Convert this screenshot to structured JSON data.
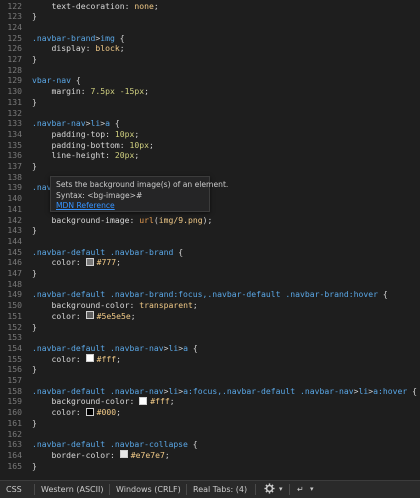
{
  "editor": {
    "lines": [
      {
        "n": "122",
        "parts": [
          [
            "prop",
            "    text-decoration"
          ],
          [
            "pun",
            ": "
          ],
          [
            "val",
            "none"
          ],
          [
            "pun",
            ";"
          ]
        ]
      },
      {
        "n": "123",
        "parts": [
          [
            "pun",
            "}"
          ]
        ]
      },
      {
        "n": "124",
        "parts": []
      },
      {
        "n": "125",
        "parts": [
          [
            "sel",
            ".navbar-brand"
          ],
          [
            "pun",
            ">"
          ],
          [
            "sel",
            "img"
          ],
          [
            "pun",
            " {"
          ]
        ]
      },
      {
        "n": "126",
        "parts": [
          [
            "prop",
            "    display"
          ],
          [
            "pun",
            ": "
          ],
          [
            "val",
            "block"
          ],
          [
            "pun",
            ";"
          ]
        ]
      },
      {
        "n": "127",
        "parts": [
          [
            "pun",
            "}"
          ]
        ]
      },
      {
        "n": "128",
        "parts": []
      },
      {
        "n": "129",
        "parts": [
          [
            "sel",
            "vbar-nav"
          ],
          [
            "pun",
            " {"
          ]
        ]
      },
      {
        "n": "130",
        "parts": [
          [
            "prop",
            "    margin"
          ],
          [
            "pun",
            ": "
          ],
          [
            "num",
            "7.5px -15px"
          ],
          [
            "pun",
            ";"
          ]
        ]
      },
      {
        "n": "131",
        "parts": [
          [
            "pun",
            "}"
          ]
        ]
      },
      {
        "n": "132",
        "parts": []
      },
      {
        "n": "133",
        "parts": [
          [
            "sel",
            ".navbar-nav"
          ],
          [
            "pun",
            ">"
          ],
          [
            "sel",
            "li"
          ],
          [
            "pun",
            ">"
          ],
          [
            "sel",
            "a"
          ],
          [
            "pun",
            " {"
          ]
        ]
      },
      {
        "n": "134",
        "parts": [
          [
            "prop",
            "    padding-top"
          ],
          [
            "pun",
            ": "
          ],
          [
            "num",
            "10px"
          ],
          [
            "pun",
            ";"
          ]
        ]
      },
      {
        "n": "135",
        "parts": [
          [
            "prop",
            "    padding-bottom"
          ],
          [
            "pun",
            ": "
          ],
          [
            "num",
            "10px"
          ],
          [
            "pun",
            ";"
          ]
        ]
      },
      {
        "n": "136",
        "parts": [
          [
            "prop",
            "    line-height"
          ],
          [
            "pun",
            ": "
          ],
          [
            "num",
            "20px"
          ],
          [
            "pun",
            ";"
          ]
        ]
      },
      {
        "n": "137",
        "parts": [
          [
            "pun",
            "}"
          ]
        ]
      },
      {
        "n": "138",
        "parts": []
      },
      {
        "n": "139",
        "parts": [
          [
            "sel",
            ".nav"
          ]
        ]
      },
      {
        "n": "140",
        "parts": []
      },
      {
        "n": "141",
        "parts": []
      },
      {
        "n": "142",
        "parts": [
          [
            "prop",
            "    background-image"
          ],
          [
            "pun",
            ": "
          ],
          [
            "kw",
            "url"
          ],
          [
            "pun",
            "("
          ],
          [
            "val",
            "img/9.png"
          ],
          [
            "pun",
            ");"
          ]
        ]
      },
      {
        "n": "143",
        "parts": [
          [
            "pun",
            "}"
          ]
        ]
      },
      {
        "n": "144",
        "parts": []
      },
      {
        "n": "145",
        "parts": [
          [
            "sel",
            ".navbar-default .navbar-brand"
          ],
          [
            "pun",
            " {"
          ]
        ]
      },
      {
        "n": "146",
        "parts": [
          [
            "prop",
            "    color"
          ],
          [
            "pun",
            ": "
          ],
          [
            "sw",
            "#777777"
          ],
          [
            "val",
            "#777"
          ],
          [
            "pun",
            ";"
          ]
        ]
      },
      {
        "n": "147",
        "parts": [
          [
            "pun",
            "}"
          ]
        ]
      },
      {
        "n": "148",
        "parts": []
      },
      {
        "n": "149",
        "parts": [
          [
            "sel",
            ".navbar-default .navbar-brand:focus,.navbar-default .navbar-brand:hover"
          ],
          [
            "pun",
            " {"
          ]
        ]
      },
      {
        "n": "150",
        "parts": [
          [
            "prop",
            "    background-color"
          ],
          [
            "pun",
            ": "
          ],
          [
            "val",
            "transparent"
          ],
          [
            "pun",
            ";"
          ]
        ]
      },
      {
        "n": "151",
        "parts": [
          [
            "prop",
            "    color"
          ],
          [
            "pun",
            ": "
          ],
          [
            "sw",
            "#5e5e5e"
          ],
          [
            "val",
            "#5e5e5e"
          ],
          [
            "pun",
            ";"
          ]
        ]
      },
      {
        "n": "152",
        "parts": [
          [
            "pun",
            "}"
          ]
        ]
      },
      {
        "n": "153",
        "parts": []
      },
      {
        "n": "154",
        "parts": [
          [
            "sel",
            ".navbar-default .navbar-nav"
          ],
          [
            "pun",
            ">"
          ],
          [
            "sel",
            "li"
          ],
          [
            "pun",
            ">"
          ],
          [
            "sel",
            "a"
          ],
          [
            "pun",
            " {"
          ]
        ]
      },
      {
        "n": "155",
        "parts": [
          [
            "prop",
            "    color"
          ],
          [
            "pun",
            ": "
          ],
          [
            "sw",
            "#ffffff"
          ],
          [
            "val",
            "#fff"
          ],
          [
            "pun",
            ";"
          ]
        ]
      },
      {
        "n": "156",
        "parts": [
          [
            "pun",
            "}"
          ]
        ]
      },
      {
        "n": "157",
        "parts": []
      },
      {
        "n": "158",
        "parts": [
          [
            "sel",
            ".navbar-default .navbar-nav"
          ],
          [
            "pun",
            ">"
          ],
          [
            "sel",
            "li"
          ],
          [
            "pun",
            ">"
          ],
          [
            "sel",
            "a:focus,.navbar-default .navbar-nav"
          ],
          [
            "pun",
            ">"
          ],
          [
            "sel",
            "li"
          ],
          [
            "pun",
            ">"
          ],
          [
            "sel",
            "a:hover"
          ],
          [
            "pun",
            " {"
          ]
        ]
      },
      {
        "n": "159",
        "parts": [
          [
            "prop",
            "    background-color"
          ],
          [
            "pun",
            ": "
          ],
          [
            "sw",
            "#ffffff"
          ],
          [
            "val",
            "#fff"
          ],
          [
            "pun",
            ";"
          ]
        ]
      },
      {
        "n": "160",
        "parts": [
          [
            "prop",
            "    color"
          ],
          [
            "pun",
            ": "
          ],
          [
            "sw",
            "#000000"
          ],
          [
            "val",
            "#000"
          ],
          [
            "pun",
            ";"
          ]
        ]
      },
      {
        "n": "161",
        "parts": [
          [
            "pun",
            "}"
          ]
        ]
      },
      {
        "n": "162",
        "parts": []
      },
      {
        "n": "163",
        "parts": [
          [
            "sel",
            ".navbar-default .navbar-collapse"
          ],
          [
            "pun",
            " {"
          ]
        ]
      },
      {
        "n": "164",
        "parts": [
          [
            "prop",
            "    border-color"
          ],
          [
            "pun",
            ": "
          ],
          [
            "sw",
            "#e7e7e7"
          ],
          [
            "val",
            "#e7e7e7"
          ],
          [
            "pun",
            ";"
          ]
        ]
      },
      {
        "n": "165",
        "parts": [
          [
            "pun",
            "}"
          ]
        ]
      }
    ]
  },
  "tooltip": {
    "description": "Sets the background image(s) of an element.",
    "syntax": "Syntax: <bg-image>#",
    "link": "MDN Reference"
  },
  "statusbar": {
    "language": "CSS",
    "encoding": "Western (ASCII)",
    "line_endings": "Windows (CRLF)",
    "indentation": "Real Tabs: (4)",
    "gear_icon": "gear-icon",
    "wrap_icon": "return-arrow-icon"
  }
}
